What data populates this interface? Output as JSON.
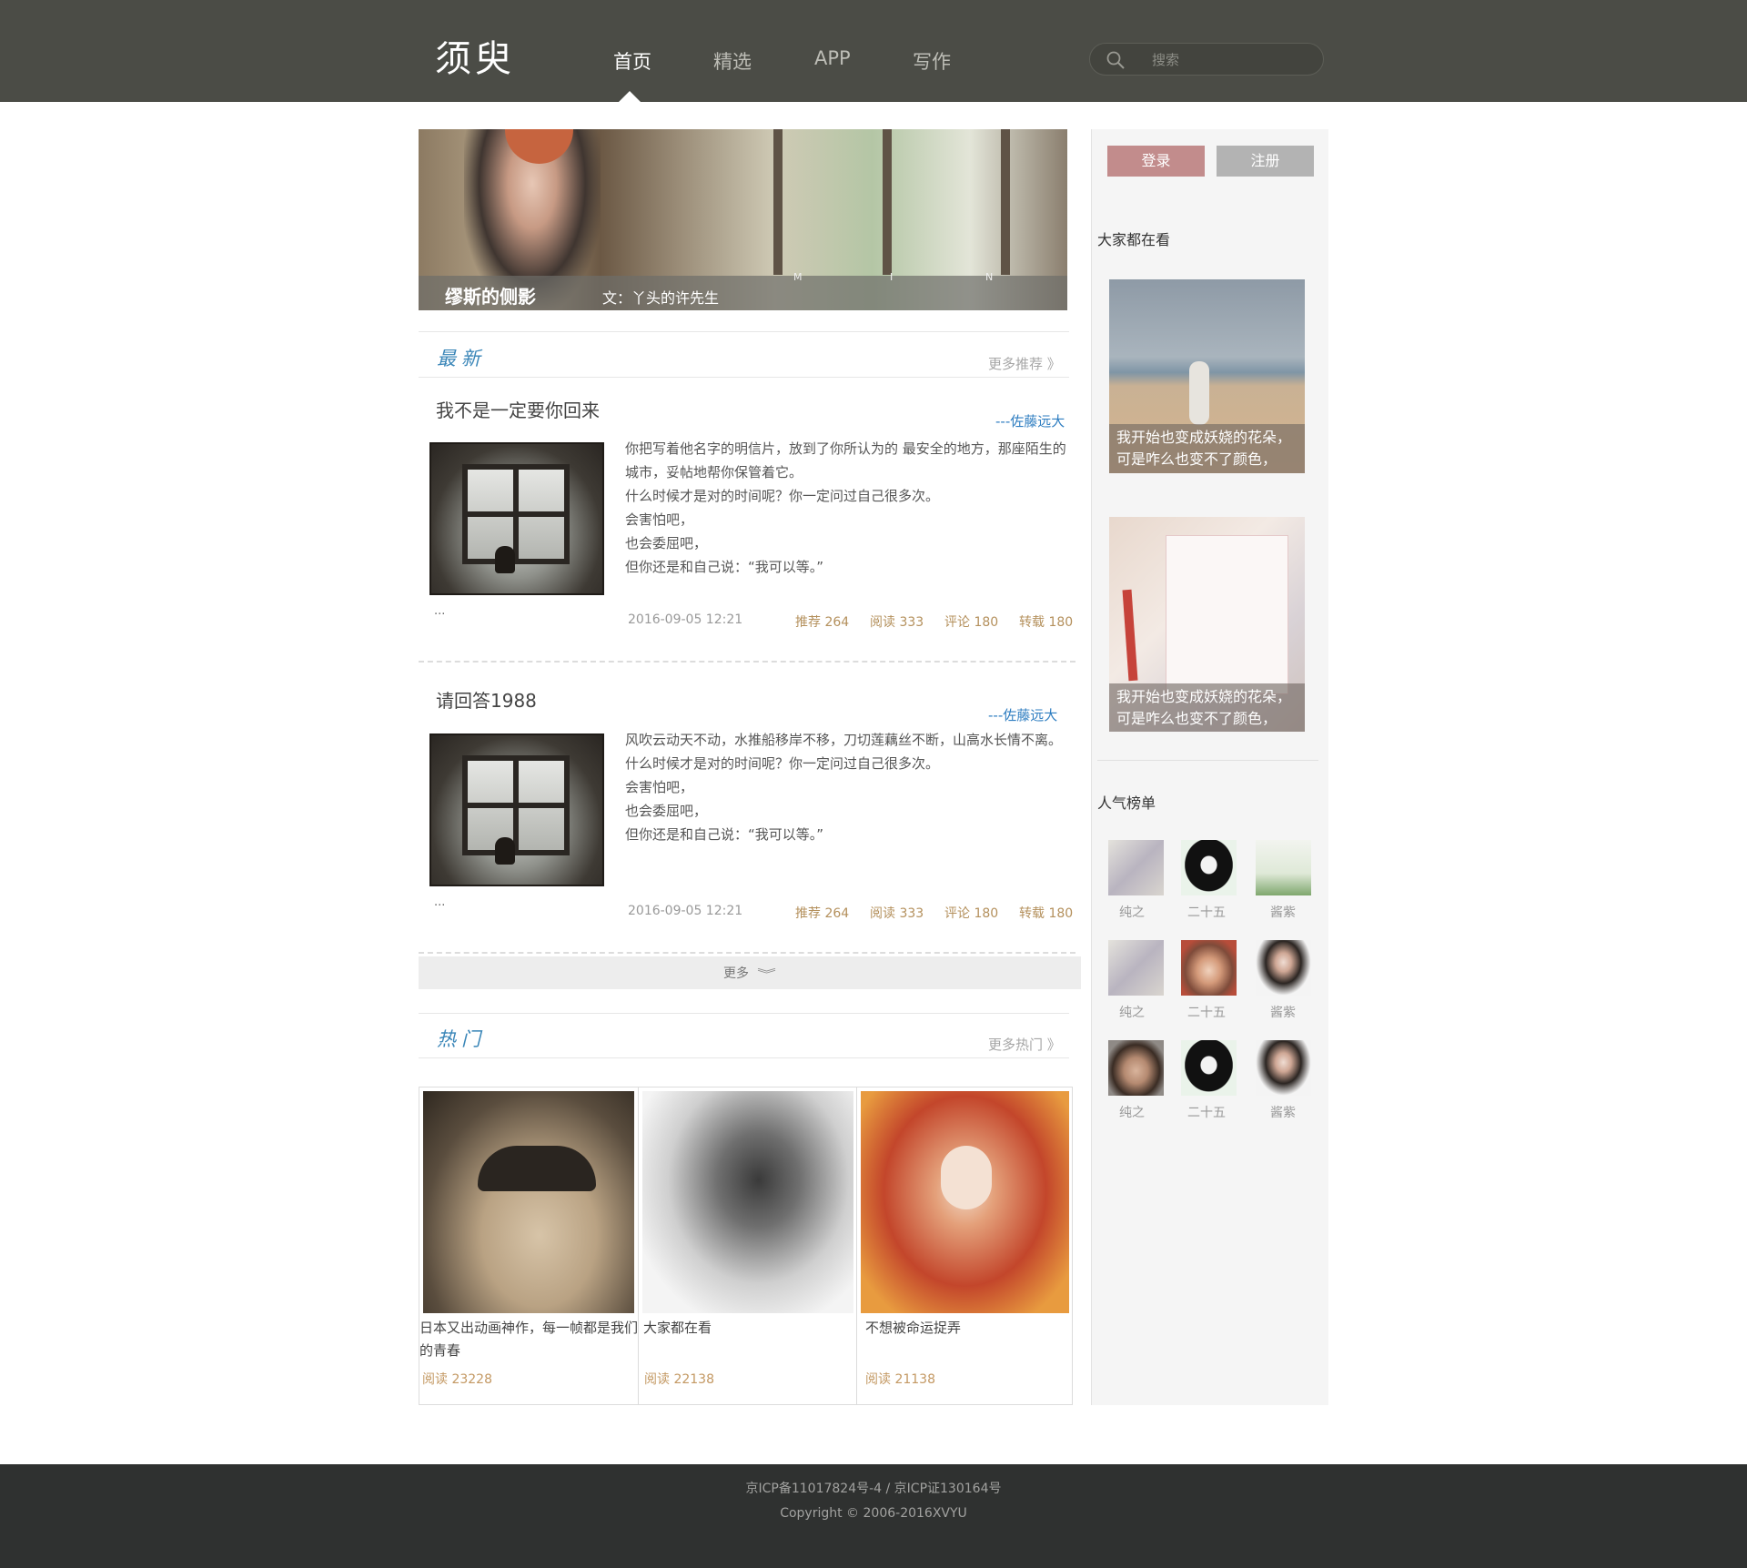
{
  "header": {
    "logo": "须臾",
    "nav": [
      {
        "label": "首页",
        "active": true
      },
      {
        "label": "精选",
        "active": false
      },
      {
        "label": "APP",
        "active": false
      },
      {
        "label": "写作",
        "active": false
      }
    ],
    "search": {
      "placeholder": "搜索",
      "value": ""
    },
    "bg_color": "#4b4c46"
  },
  "banner": {
    "title": "缪斯的侧影",
    "author": "文：丫头的许先生",
    "letters": [
      "M",
      "I",
      "N"
    ]
  },
  "latest": {
    "section_title": "最新",
    "more_label": "更多推荐 》",
    "articles": [
      {
        "title": "我不是一定要你回来",
        "author": "---佐藤远大",
        "lines": [
          "你把写着他名字的明信片，放到了你所认为的 最安全的地方，那座陌生的城市，妥帖地帮你保管着它。",
          "什么时候才是对的时间呢？你一定问过自己很多次。",
          "会害怕吧，",
          "也会委屈吧，",
          "但你还是和自己说：“我可以等。”"
        ],
        "ellipsis": "...",
        "date": "2016-09-05 12:21",
        "stats": {
          "recommend": "推荐 264",
          "read": "阅读 333",
          "comment": "评论 180",
          "repost": "转载 180"
        }
      },
      {
        "title": "请回答1988",
        "author": "---佐藤远大",
        "lines": [
          "风吹云动天不动，水推船移岸不移，刀切莲藕丝不断，山高水长情不离。",
          "什么时候才是对的时间呢？你一定问过自己很多次。",
          "会害怕吧，",
          "也会委屈吧，",
          "但你还是和自己说：“我可以等。”"
        ],
        "ellipsis": "...",
        "date": "2016-09-05 12:21",
        "stats": {
          "recommend": "推荐 264",
          "read": "阅读 333",
          "comment": "评论 180",
          "repost": "转载 180"
        }
      }
    ],
    "load_more_label": "更多",
    "load_more_icon": "double-chevron-down-icon"
  },
  "hot": {
    "section_title": "热门",
    "more_label": "更多热门 》",
    "cards": [
      {
        "caption": "日本又出动画神作，每一帧都是我们的青春",
        "read": "阅读 23228"
      },
      {
        "caption": "大家都在看",
        "read": "阅读 22138"
      },
      {
        "caption": "不想被命运捉弄",
        "read": "阅读 21138"
      }
    ]
  },
  "sidebar": {
    "login_label": "登录",
    "register_label": "注册",
    "watching_heading": "大家都在看",
    "watching_cards": [
      {
        "caption": "我开始也变成妖娆的花朵，可是咋么也变不了颜色，"
      },
      {
        "caption": "我开始也变成妖娆的花朵，可是咋么也变不了颜色，"
      }
    ],
    "ranking_heading": "人气榜单",
    "ranking": [
      {
        "name": "纯之"
      },
      {
        "name": "二十五"
      },
      {
        "name": "酱紫"
      },
      {
        "name": "纯之"
      },
      {
        "name": "二十五"
      },
      {
        "name": "酱紫"
      },
      {
        "name": "纯之"
      },
      {
        "name": "二十五"
      },
      {
        "name": "酱紫"
      }
    ]
  },
  "footer": {
    "line1": "京ICP备11017824号-4 / 京ICP证130164号",
    "line2": "Copyright © 2006-2016XVYU"
  },
  "colors": {
    "accent_blue": "#3a86b8",
    "stat_gold": "#b4905c",
    "login_pink": "#c28c8c",
    "register_gray": "#b3b3b3",
    "footer_bg": "#2f3130"
  }
}
